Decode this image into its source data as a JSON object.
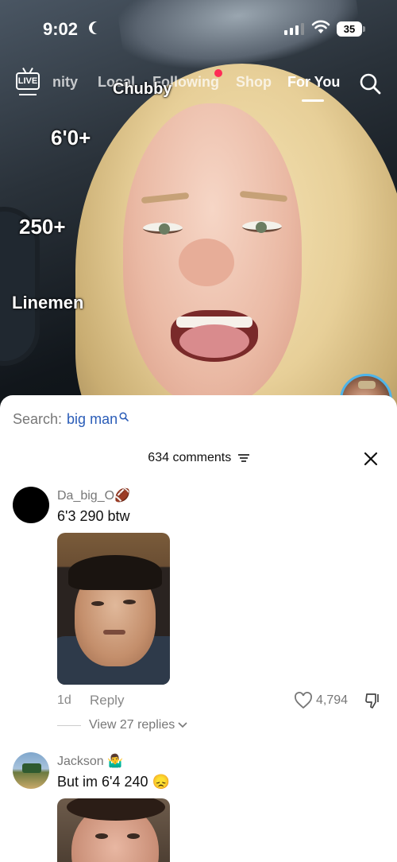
{
  "status_bar": {
    "time": "9:02",
    "battery": "35"
  },
  "nav": {
    "tabs": [
      "nity",
      "Local",
      "Following",
      "Shop",
      "For You"
    ],
    "active_tab": "For You",
    "live_label": "LIVE"
  },
  "overlay": {
    "labels": [
      "Chubby",
      "6'0+",
      "250+",
      "Linemen"
    ]
  },
  "search": {
    "prefix": "Search:",
    "term": "big man"
  },
  "comments_header": {
    "count_label": "634 comments"
  },
  "comments": [
    {
      "username": "Da_big_O🏈",
      "text": "6'3 290 btw",
      "date": "1d",
      "reply_label": "Reply",
      "likes": "4,794",
      "view_replies": "View 27 replies"
    },
    {
      "username": "Jackson 🤷‍♂️",
      "text": "But im 6'4 240 😞"
    }
  ],
  "colors": {
    "accent_link": "#2b5db8",
    "live_dot": "#fe2c55",
    "avatar_ring": "#4fb4e8"
  }
}
